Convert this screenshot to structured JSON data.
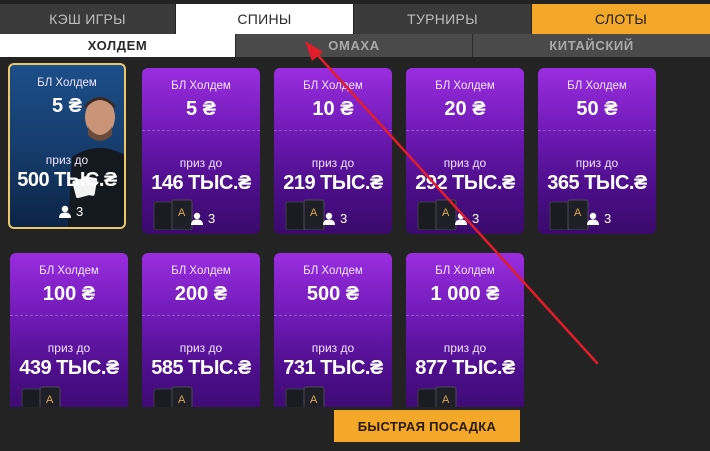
{
  "top_tabs": [
    {
      "label": "КЭШ ИГРЫ"
    },
    {
      "label": "СПИНЫ"
    },
    {
      "label": "ТУРНИРЫ"
    },
    {
      "label": "СЛОТЫ"
    }
  ],
  "sub_tabs": [
    {
      "label": "ХОЛДЕМ"
    },
    {
      "label": "ОМАХА"
    },
    {
      "label": "КИТАЙСКИЙ"
    }
  ],
  "cards": [
    {
      "game": "БЛ Холдем",
      "stake": "5 ₴",
      "prize_label": "приз до",
      "prize": "500 ТЫС.₴",
      "players": "3",
      "featured": true
    },
    {
      "game": "БЛ Холдем",
      "stake": "5 ₴",
      "prize_label": "приз до",
      "prize": "146 ТЫС.₴",
      "players": "3"
    },
    {
      "game": "БЛ Холдем",
      "stake": "10 ₴",
      "prize_label": "приз до",
      "prize": "219 ТЫС.₴",
      "players": "3"
    },
    {
      "game": "БЛ Холдем",
      "stake": "20 ₴",
      "prize_label": "приз до",
      "prize": "292 ТЫС.₴",
      "players": "3"
    },
    {
      "game": "БЛ Холдем",
      "stake": "50 ₴",
      "prize_label": "приз до",
      "prize": "365 ТЫС.₴",
      "players": "3"
    },
    {
      "game": "БЛ Холдем",
      "stake": "100 ₴",
      "prize_label": "приз до",
      "prize": "439 ТЫС.₴"
    },
    {
      "game": "БЛ Холдем",
      "stake": "200 ₴",
      "prize_label": "приз до",
      "prize": "585 ТЫС.₴"
    },
    {
      "game": "БЛ Холдем",
      "stake": "500 ₴",
      "prize_label": "приз до",
      "prize": "731 ТЫС.₴"
    },
    {
      "game": "БЛ Холдем",
      "stake": "1 000 ₴",
      "prize_label": "приз до",
      "prize": "877 ТЫС.₴"
    }
  ],
  "quick_seat_label": "БЫСТРАЯ ПОСАДКА",
  "colors": {
    "accent": "#f3a82a",
    "card_purple": "#6d19b4",
    "featured_border": "#e9c76a",
    "arrow": "#e11d2a"
  },
  "icons": {
    "players": "user-icon",
    "cards": "playing-cards-icon"
  }
}
